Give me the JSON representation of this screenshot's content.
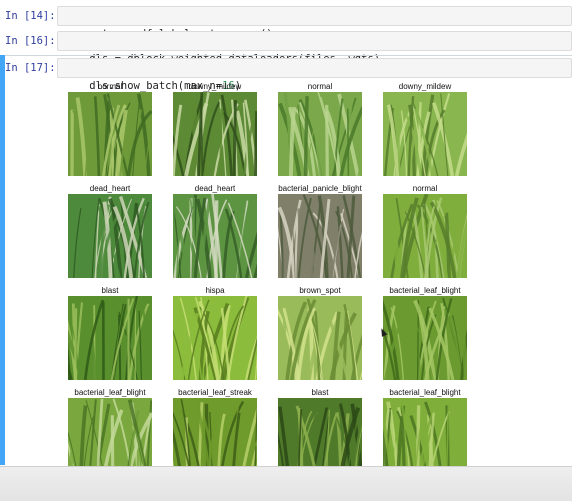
{
  "cells": [
    {
      "prompt": "In [14]:",
      "code": "wgts = wdf.label_y.to_numpy()"
    },
    {
      "prompt": "In [16]:",
      "code": "dls = dblock.weighted_dataloaders(files, wgts)"
    },
    {
      "prompt": "In [17]:",
      "code_prefix": "dls.show_batch(max_n=",
      "code_num": "16",
      "code_suffix": ")"
    }
  ],
  "batch": [
    {
      "label": "normal",
      "colors": [
        "#6f9a3a",
        "#a9c76a",
        "#3f6b22"
      ]
    },
    {
      "label": "downy_mildew",
      "colors": [
        "#5d8a34",
        "#c9d9a4",
        "#2f4f1b"
      ]
    },
    {
      "label": "normal",
      "colors": [
        "#7aa84a",
        "#b8d58e",
        "#4a7a2a"
      ]
    },
    {
      "label": "downy_mildew",
      "colors": [
        "#8ab64f",
        "#c4dd8a",
        "#557d2c"
      ]
    },
    {
      "label": "dead_heart",
      "colors": [
        "#4e8a3c",
        "#cfd6b8",
        "#2f5a23"
      ]
    },
    {
      "label": "dead_heart",
      "colors": [
        "#5c9442",
        "#d5dbc2",
        "#355e27"
      ]
    },
    {
      "label": "bacterial_panicle_blight",
      "colors": [
        "#7f7f6a",
        "#d8d4c4",
        "#4d5a3c"
      ]
    },
    {
      "label": "normal",
      "colors": [
        "#7fae3c",
        "#a9c972",
        "#567e2b"
      ]
    },
    {
      "label": "blast",
      "colors": [
        "#5a8f2e",
        "#9bc05a",
        "#2f5a16"
      ]
    },
    {
      "label": "hispa",
      "colors": [
        "#8cbc3c",
        "#c7df74",
        "#577d1f"
      ]
    },
    {
      "label": "brown_spot",
      "colors": [
        "#9abb5a",
        "#d2e28c",
        "#6a8c34"
      ]
    },
    {
      "label": "bacterial_leaf_blight",
      "colors": [
        "#6a9a30",
        "#a4c764",
        "#3e6a1a"
      ]
    },
    {
      "label": "bacterial_leaf_blight",
      "colors": [
        "#7aa83e",
        "#c2d898",
        "#4a7424"
      ]
    },
    {
      "label": "bacterial_leaf_streak",
      "colors": [
        "#6f9a2c",
        "#b6cf6a",
        "#3d5e18"
      ]
    },
    {
      "label": "blast",
      "colors": [
        "#4f7a2a",
        "#8db04e",
        "#2c4916"
      ]
    },
    {
      "label": "bacterial_leaf_blight",
      "colors": [
        "#7fae3a",
        "#b7d474",
        "#4b7622"
      ]
    }
  ]
}
